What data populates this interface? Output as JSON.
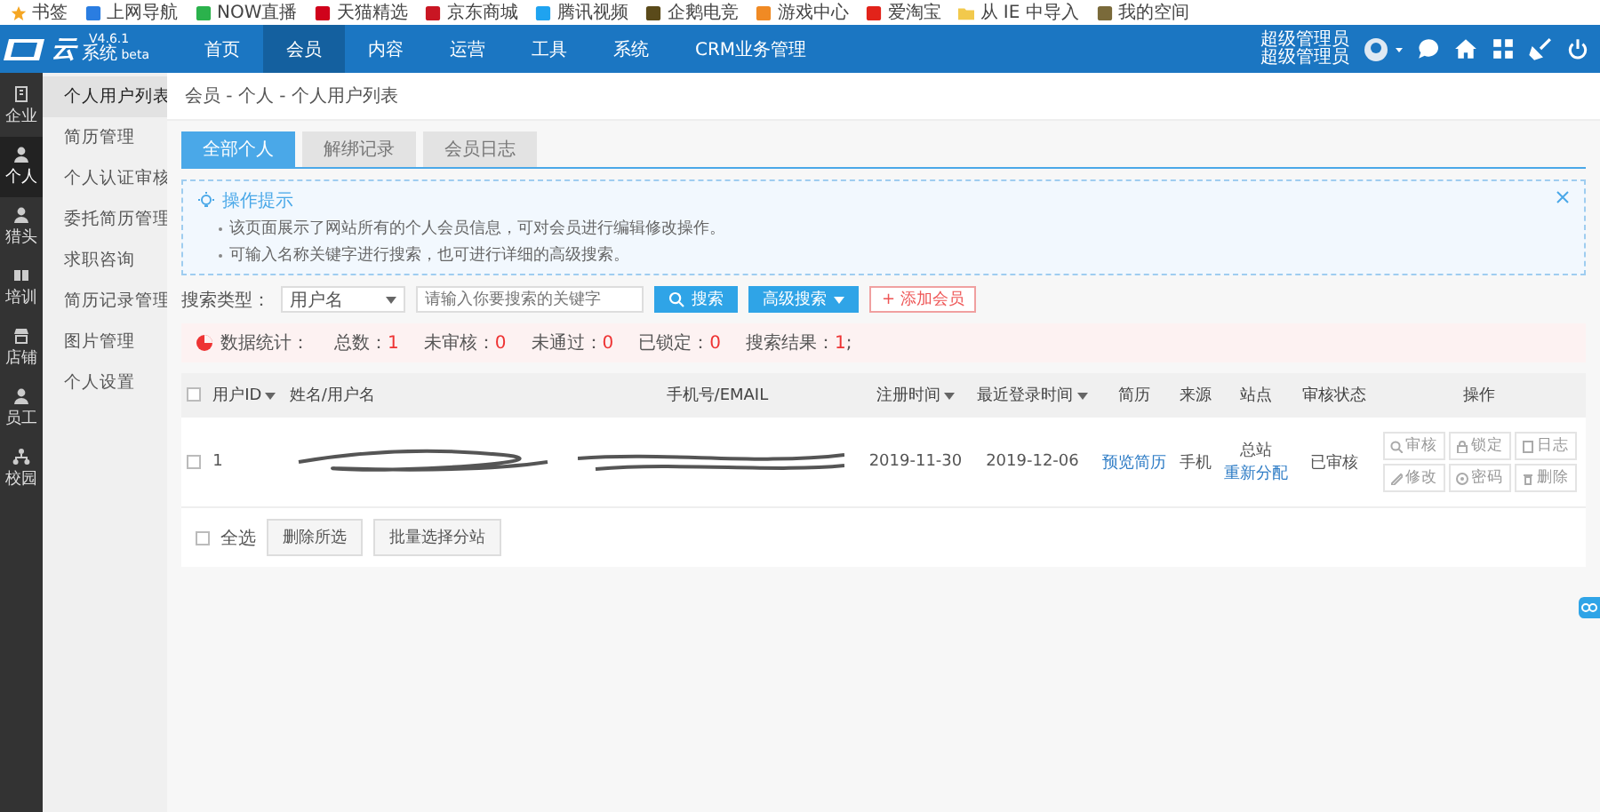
{
  "bookmarks": [
    {
      "label": "书签",
      "kind": "star",
      "color": "#f5a623"
    },
    {
      "label": "上网导航",
      "kind": "site",
      "color": "#2a7de1"
    },
    {
      "label": "NOW直播",
      "kind": "site",
      "color": "#2bb24c"
    },
    {
      "label": "天猫精选",
      "kind": "site",
      "color": "#d0021b"
    },
    {
      "label": "京东商城",
      "kind": "site",
      "color": "#c91623"
    },
    {
      "label": "腾讯视频",
      "kind": "site",
      "color": "#1fa3f0"
    },
    {
      "label": "企鹅电竞",
      "kind": "site",
      "color": "#5a4a1a"
    },
    {
      "label": "游戏中心",
      "kind": "site",
      "color": "#f08a24"
    },
    {
      "label": "爱淘宝",
      "kind": "site",
      "color": "#e2231a"
    },
    {
      "label": "从 IE 中导入",
      "kind": "folder",
      "color": "#f2c94c"
    },
    {
      "label": "我的空间",
      "kind": "site",
      "color": "#7a6a3a"
    }
  ],
  "app": {
    "logo_text": "云",
    "name": "系统",
    "version": "V4.6.1",
    "edition": "beta"
  },
  "nav": [
    {
      "label": "首页",
      "selected": false
    },
    {
      "label": "会员",
      "selected": true
    },
    {
      "label": "内容",
      "selected": false
    },
    {
      "label": "运营",
      "selected": false
    },
    {
      "label": "工具",
      "selected": false
    },
    {
      "label": "系统",
      "selected": false
    },
    {
      "label": "CRM业务管理",
      "selected": false
    }
  ],
  "user": {
    "lines": [
      "超级管理员",
      "超级管理员"
    ]
  },
  "side_nav": [
    {
      "label": "企业",
      "selected": false,
      "kind": "building"
    },
    {
      "label": "个人",
      "selected": true,
      "kind": "person"
    },
    {
      "label": "猎头",
      "selected": false,
      "kind": "person"
    },
    {
      "label": "培训",
      "selected": false,
      "kind": "book"
    },
    {
      "label": "店铺",
      "selected": false,
      "kind": "shop"
    },
    {
      "label": "员工",
      "selected": false,
      "kind": "person"
    },
    {
      "label": "校园",
      "selected": false,
      "kind": "tree"
    }
  ],
  "sub_nav": [
    {
      "label": "个人用户列表",
      "selected": true
    },
    {
      "label": "简历管理",
      "selected": false
    },
    {
      "label": "个人认证审核",
      "selected": false
    },
    {
      "label": "委托简历管理",
      "selected": false
    },
    {
      "label": "求职咨询",
      "selected": false
    },
    {
      "label": "简历记录管理",
      "selected": false
    },
    {
      "label": "图片管理",
      "selected": false
    },
    {
      "label": "个人设置",
      "selected": false
    }
  ],
  "breadcrumb": "会员 - 个人 - 个人用户列表",
  "tabs": [
    {
      "label": "全部个人",
      "selected": true
    },
    {
      "label": "解绑记录",
      "selected": false
    },
    {
      "label": "会员日志",
      "selected": false
    }
  ],
  "tips": {
    "title": "操作提示",
    "lines": [
      "该页面展示了网站所有的个人会员信息，可对会员进行编辑修改操作。",
      "可输入名称关键字进行搜索，也可进行详细的高级搜索。"
    ]
  },
  "search": {
    "label": "搜索类型：",
    "type_value": "用户名",
    "placeholder": "请输入你要搜索的关键字",
    "search_button": "搜索",
    "advanced_button": "高级搜索",
    "add_button": "+ 添加会员"
  },
  "stats": {
    "label": "数据统计：",
    "items": [
      {
        "label": "总数：",
        "value": "1"
      },
      {
        "label": "未审核：",
        "value": "0"
      },
      {
        "label": "未通过：",
        "value": "0"
      },
      {
        "label": "已锁定：",
        "value": "0"
      },
      {
        "label": "搜索结果：",
        "value": "1",
        "suffix": ";"
      }
    ]
  },
  "table": {
    "header_checked": false,
    "columns": [
      {
        "label": "用户ID",
        "sortable": true
      },
      {
        "label": "姓名/用户名",
        "sortable": false
      },
      {
        "label": "手机号/EMAIL",
        "sortable": false
      },
      {
        "label": "注册时间",
        "sortable": true
      },
      {
        "label": "最近登录时间",
        "sortable": true
      },
      {
        "label": "简历",
        "sortable": false
      },
      {
        "label": "来源",
        "sortable": false
      },
      {
        "label": "站点",
        "sortable": false
      },
      {
        "label": "审核状态",
        "sortable": false
      },
      {
        "label": "操作",
        "sortable": false
      }
    ],
    "rows": [
      {
        "checked": false,
        "id": "1",
        "registered": "2019-11-30",
        "last_login": "2019-12-06",
        "resume": "预览简历",
        "source": "手机",
        "site": "总站",
        "site_action": "重新分配",
        "status": "已审核",
        "actions": [
          {
            "label": "审核",
            "kind": "audit"
          },
          {
            "label": "锁定",
            "kind": "lock"
          },
          {
            "label": "日志",
            "kind": "log"
          },
          {
            "label": "修改",
            "kind": "edit"
          },
          {
            "label": "密码",
            "kind": "password"
          },
          {
            "label": "删除",
            "kind": "delete"
          }
        ]
      }
    ]
  },
  "footer": {
    "select_all": {
      "label": "全选",
      "checked": false
    },
    "buttons": [
      "删除所选",
      "批量选择分站"
    ]
  }
}
